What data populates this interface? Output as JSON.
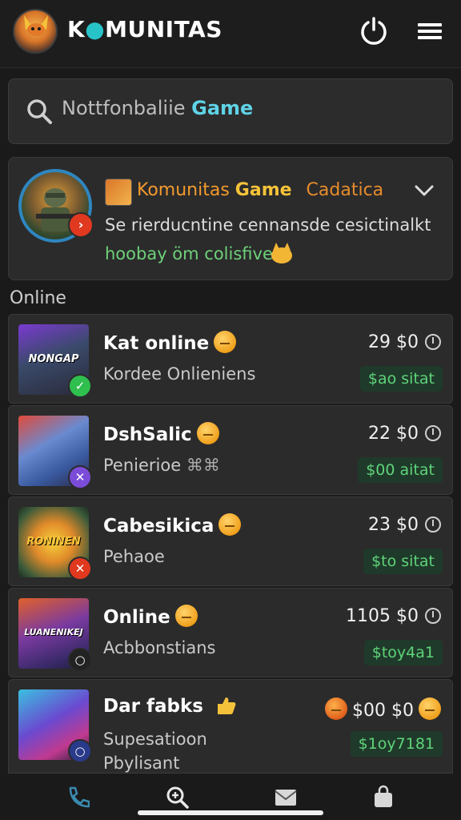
{
  "header": {
    "title_prefix": "K",
    "title_rest": "MUNITAS"
  },
  "search": {
    "placeholder_text": "Nottfonbaliie",
    "placeholder_highlight": "Game"
  },
  "featured": {
    "title": "Komunitas",
    "game": "Game",
    "category": "Cadatica",
    "description": "Se rierduc​ntine cennansde cesictinalkt",
    "tag": "hoobay öm colisfive"
  },
  "section": {
    "online_label": "Online"
  },
  "players": [
    {
      "name": "Kat online",
      "subtitle": "Kordee Onlieniens",
      "price": "29 $0",
      "tag": "$ao sitat",
      "thumb_caption": "NONGAP",
      "status": "check",
      "status_glyph": "✓",
      "status_color": "#2fbf4f"
    },
    {
      "name": "DshSalic",
      "subtitle": "Penierioe",
      "subtitle_extra": "⌘⌘",
      "price": "22 $0",
      "tag": "$00 aitat",
      "thumb_caption": "",
      "status": "cross-purple",
      "status_glyph": "✕",
      "status_color": "#7b4cd8"
    },
    {
      "name": "Cabesikica",
      "subtitle": "Pehaoe",
      "price": "23 $0",
      "tag": "$to sitat",
      "thumb_caption": "RONINEN",
      "status": "cross",
      "status_glyph": "✕",
      "status_color": "#e0391f"
    },
    {
      "name": "Online",
      "subtitle": "Acbbonstians",
      "price": "1105 $0",
      "tag": "$toy4a1",
      "thumb_caption": "LUANENIKEJ",
      "status": "ring",
      "status_glyph": "○",
      "status_color": "#222222"
    },
    {
      "name": "Dar fabks",
      "subtitle": "Supesatioon",
      "subtitle2": "Pbylisant",
      "price": "$00 $0",
      "tag": "$1oy7181",
      "thumb_caption": "",
      "status": "ring-blue",
      "status_glyph": "○",
      "status_color": "#2a3a8a"
    }
  ],
  "colors": {
    "background": "#1a1a1a",
    "card": "#2b2b2b",
    "accent_cyan": "#28c3c8",
    "accent_orange": "#f39a2e",
    "tag_green": "#5fd37a"
  },
  "bottom_nav": [
    {
      "icon": "phone-icon"
    },
    {
      "icon": "search-zoom-icon"
    },
    {
      "icon": "mail-icon"
    },
    {
      "icon": "bag-icon"
    }
  ]
}
